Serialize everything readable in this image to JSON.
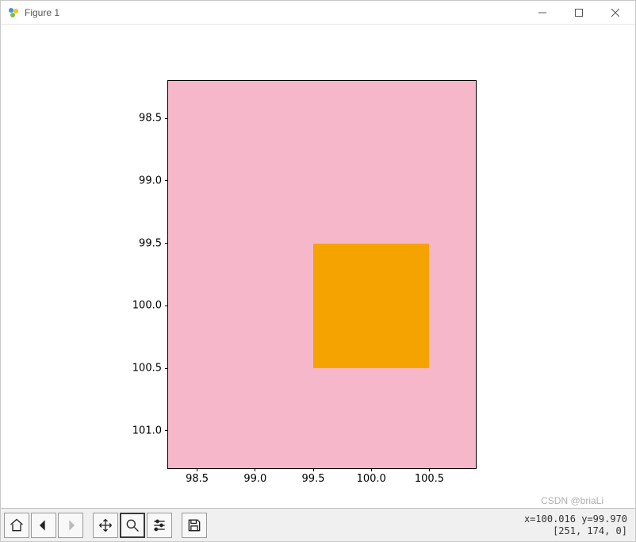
{
  "window": {
    "title": "Figure 1"
  },
  "chart_data": {
    "type": "heatmap",
    "xlim": [
      98.25,
      100.9
    ],
    "ylim": [
      98.2,
      101.3
    ],
    "y_inverted": true,
    "xticks": [
      98.5,
      99.0,
      99.5,
      100.0,
      100.5
    ],
    "yticks": [
      98.5,
      99.0,
      99.5,
      100.0,
      100.5,
      101.0
    ],
    "xtick_labels": [
      "98.5",
      "99.0",
      "99.5",
      "100.0",
      "100.5"
    ],
    "ytick_labels": [
      "98.5",
      "99.0",
      "99.5",
      "100.0",
      "100.5",
      "101.0"
    ],
    "background_color": "#f7b7ca",
    "regions": [
      {
        "x0": 99.5,
        "x1": 100.5,
        "y0": 99.5,
        "y1": 100.5,
        "color": "#f4a300"
      }
    ]
  },
  "toolbar": {
    "buttons": [
      {
        "name": "home",
        "label": "Home"
      },
      {
        "name": "back",
        "label": "Back"
      },
      {
        "name": "forward",
        "label": "Forward"
      },
      {
        "name": "pan",
        "label": "Pan"
      },
      {
        "name": "zoom",
        "label": "Zoom",
        "active": true
      },
      {
        "name": "subplots",
        "label": "Configure subplots"
      },
      {
        "name": "save",
        "label": "Save"
      }
    ],
    "status_coords": "x=100.016 y=99.970",
    "status_pixel": "[251, 174, 0]"
  },
  "watermark": "CSDN @briaLi"
}
